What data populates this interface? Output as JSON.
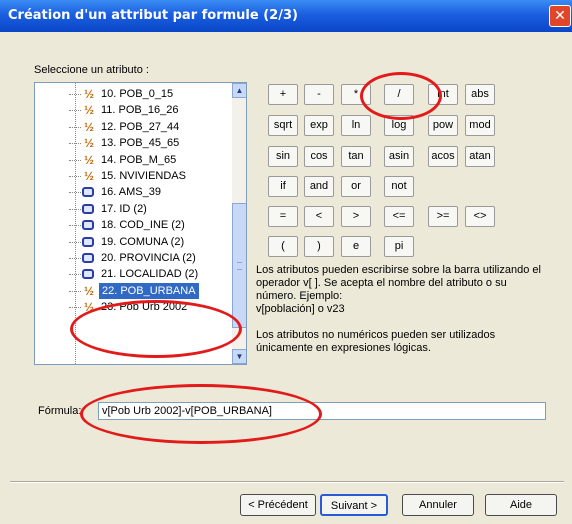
{
  "window": {
    "title": "Création d'un attribut par formule (2/3)",
    "close_glyph": "✕"
  },
  "prompt": "Seleccione un atributo :",
  "attributes": [
    {
      "label": "10. POB_0_15",
      "kind": "num"
    },
    {
      "label": "11. POB_16_26",
      "kind": "num"
    },
    {
      "label": "12. POB_27_44",
      "kind": "num"
    },
    {
      "label": "13. POB_45_65",
      "kind": "num"
    },
    {
      "label": "14. POB_M_65",
      "kind": "num"
    },
    {
      "label": "15. NVIVIENDAS",
      "kind": "num"
    },
    {
      "label": "16. AMS_39",
      "kind": "txt"
    },
    {
      "label": "17. ID (2)",
      "kind": "txt"
    },
    {
      "label": "18. COD_INE (2)",
      "kind": "txt"
    },
    {
      "label": "19. COMUNA (2)",
      "kind": "txt"
    },
    {
      "label": "20. PROVINCIA (2)",
      "kind": "txt"
    },
    {
      "label": "21. LOCALIDAD (2)",
      "kind": "txt"
    },
    {
      "label": "22. POB_URBANA",
      "kind": "num",
      "selected": true
    },
    {
      "label": "23. Pob Urb 2002",
      "kind": "num"
    }
  ],
  "operators": [
    [
      "+",
      "-",
      "*",
      "/",
      "int",
      "abs"
    ],
    [
      "sqrt",
      "exp",
      "ln",
      "log",
      "pow",
      "mod"
    ],
    [
      "sin",
      "cos",
      "tan",
      "asin",
      "acos",
      "atan"
    ],
    [
      "if",
      "and",
      "or",
      "not"
    ],
    [
      "=",
      "<",
      ">",
      "<=",
      ">=",
      "<>"
    ],
    [
      "(",
      ")",
      "e",
      "pi"
    ]
  ],
  "help": {
    "p1_line1": "Los atributos pueden escribirse sobre la barra utilizando el",
    "p1_line2": "operador v[ ]. Se acepta el nombre del atributo o su",
    "p1_line3": "número. Ejemplo:",
    "p1_line4": "v[población] o v23",
    "p2_line1": "Los atributos no numéricos pueden ser utilizados",
    "p2_line2": "únicamente en expresiones lógicas."
  },
  "formula": {
    "label": "Fórmula:",
    "value": "v[Pob Urb 2002]-v[POB_URBANA]"
  },
  "buttons": {
    "prev": "< Précédent",
    "next": "Suivant >",
    "cancel": "Annuler",
    "help": "Aide"
  },
  "annotation_color": "#e21a1a"
}
